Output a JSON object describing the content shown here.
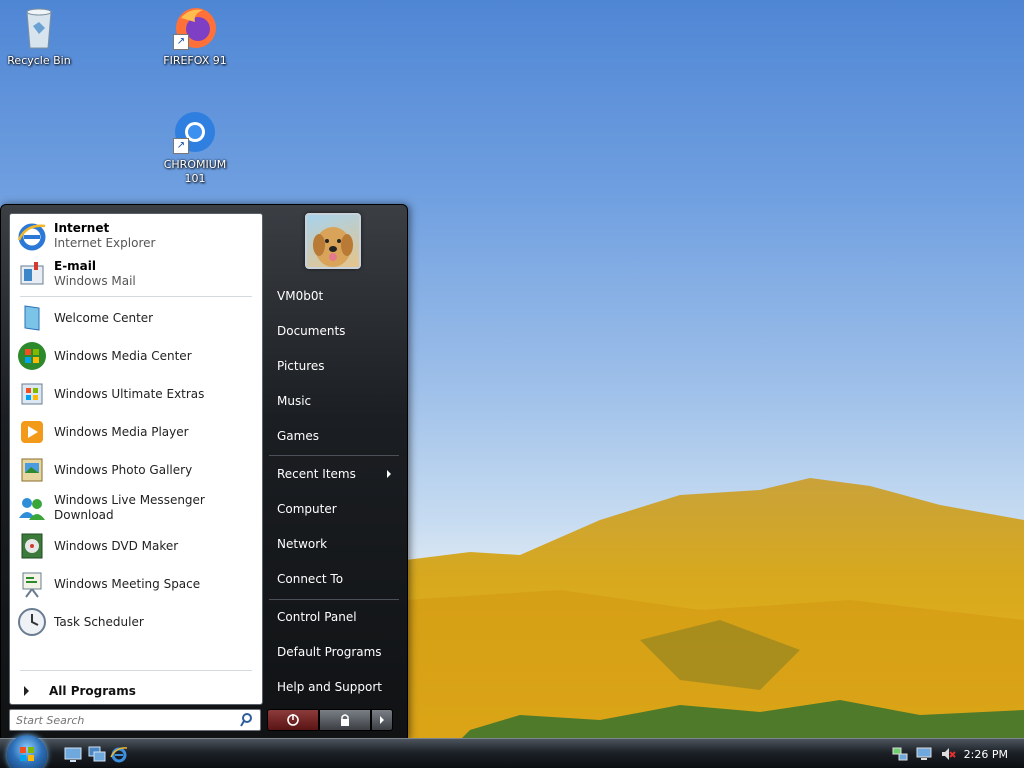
{
  "desktop": {
    "icons": [
      {
        "label": "Recycle Bin",
        "icon": "recycle-bin-icon"
      },
      {
        "label": "FIREFOX 91",
        "icon": "firefox-icon"
      },
      {
        "label": "CHROMIUM 101",
        "icon": "chromium-icon"
      }
    ]
  },
  "start_menu": {
    "pinned": [
      {
        "title": "Internet",
        "subtitle": "Internet Explorer",
        "icon": "internet-explorer-icon"
      },
      {
        "title": "E-mail",
        "subtitle": "Windows Mail",
        "icon": "windows-mail-icon"
      }
    ],
    "recent": [
      {
        "label": "Welcome Center",
        "icon": "welcome-center-icon"
      },
      {
        "label": "Windows Media Center",
        "icon": "media-center-icon"
      },
      {
        "label": "Windows Ultimate Extras",
        "icon": "ultimate-extras-icon"
      },
      {
        "label": "Windows Media Player",
        "icon": "media-player-icon"
      },
      {
        "label": "Windows Photo Gallery",
        "icon": "photo-gallery-icon"
      },
      {
        "label": "Windows Live Messenger Download",
        "icon": "messenger-icon"
      },
      {
        "label": "Windows DVD Maker",
        "icon": "dvd-maker-icon"
      },
      {
        "label": "Windows Meeting Space",
        "icon": "meeting-space-icon"
      },
      {
        "label": "Task Scheduler",
        "icon": "task-scheduler-icon"
      }
    ],
    "all_programs": "All Programs",
    "search_placeholder": "Start Search",
    "user_name": "VM0b0t",
    "right_items": [
      "Documents",
      "Pictures",
      "Music",
      "Games",
      "Recent Items",
      "Computer",
      "Network",
      "Connect To",
      "Control Panel",
      "Default Programs",
      "Help and Support"
    ]
  },
  "taskbar": {
    "clock": "2:26 PM",
    "quick_launch": [
      "show-desktop-icon",
      "switch-windows-icon",
      "internet-explorer-icon"
    ],
    "tray": [
      "network-icon",
      "display-icon",
      "volume-muted-icon"
    ]
  },
  "colors": {
    "taskbar": "#1c2127",
    "start_menu_right": "#1b1e22",
    "orb": "#2c6fb8"
  }
}
